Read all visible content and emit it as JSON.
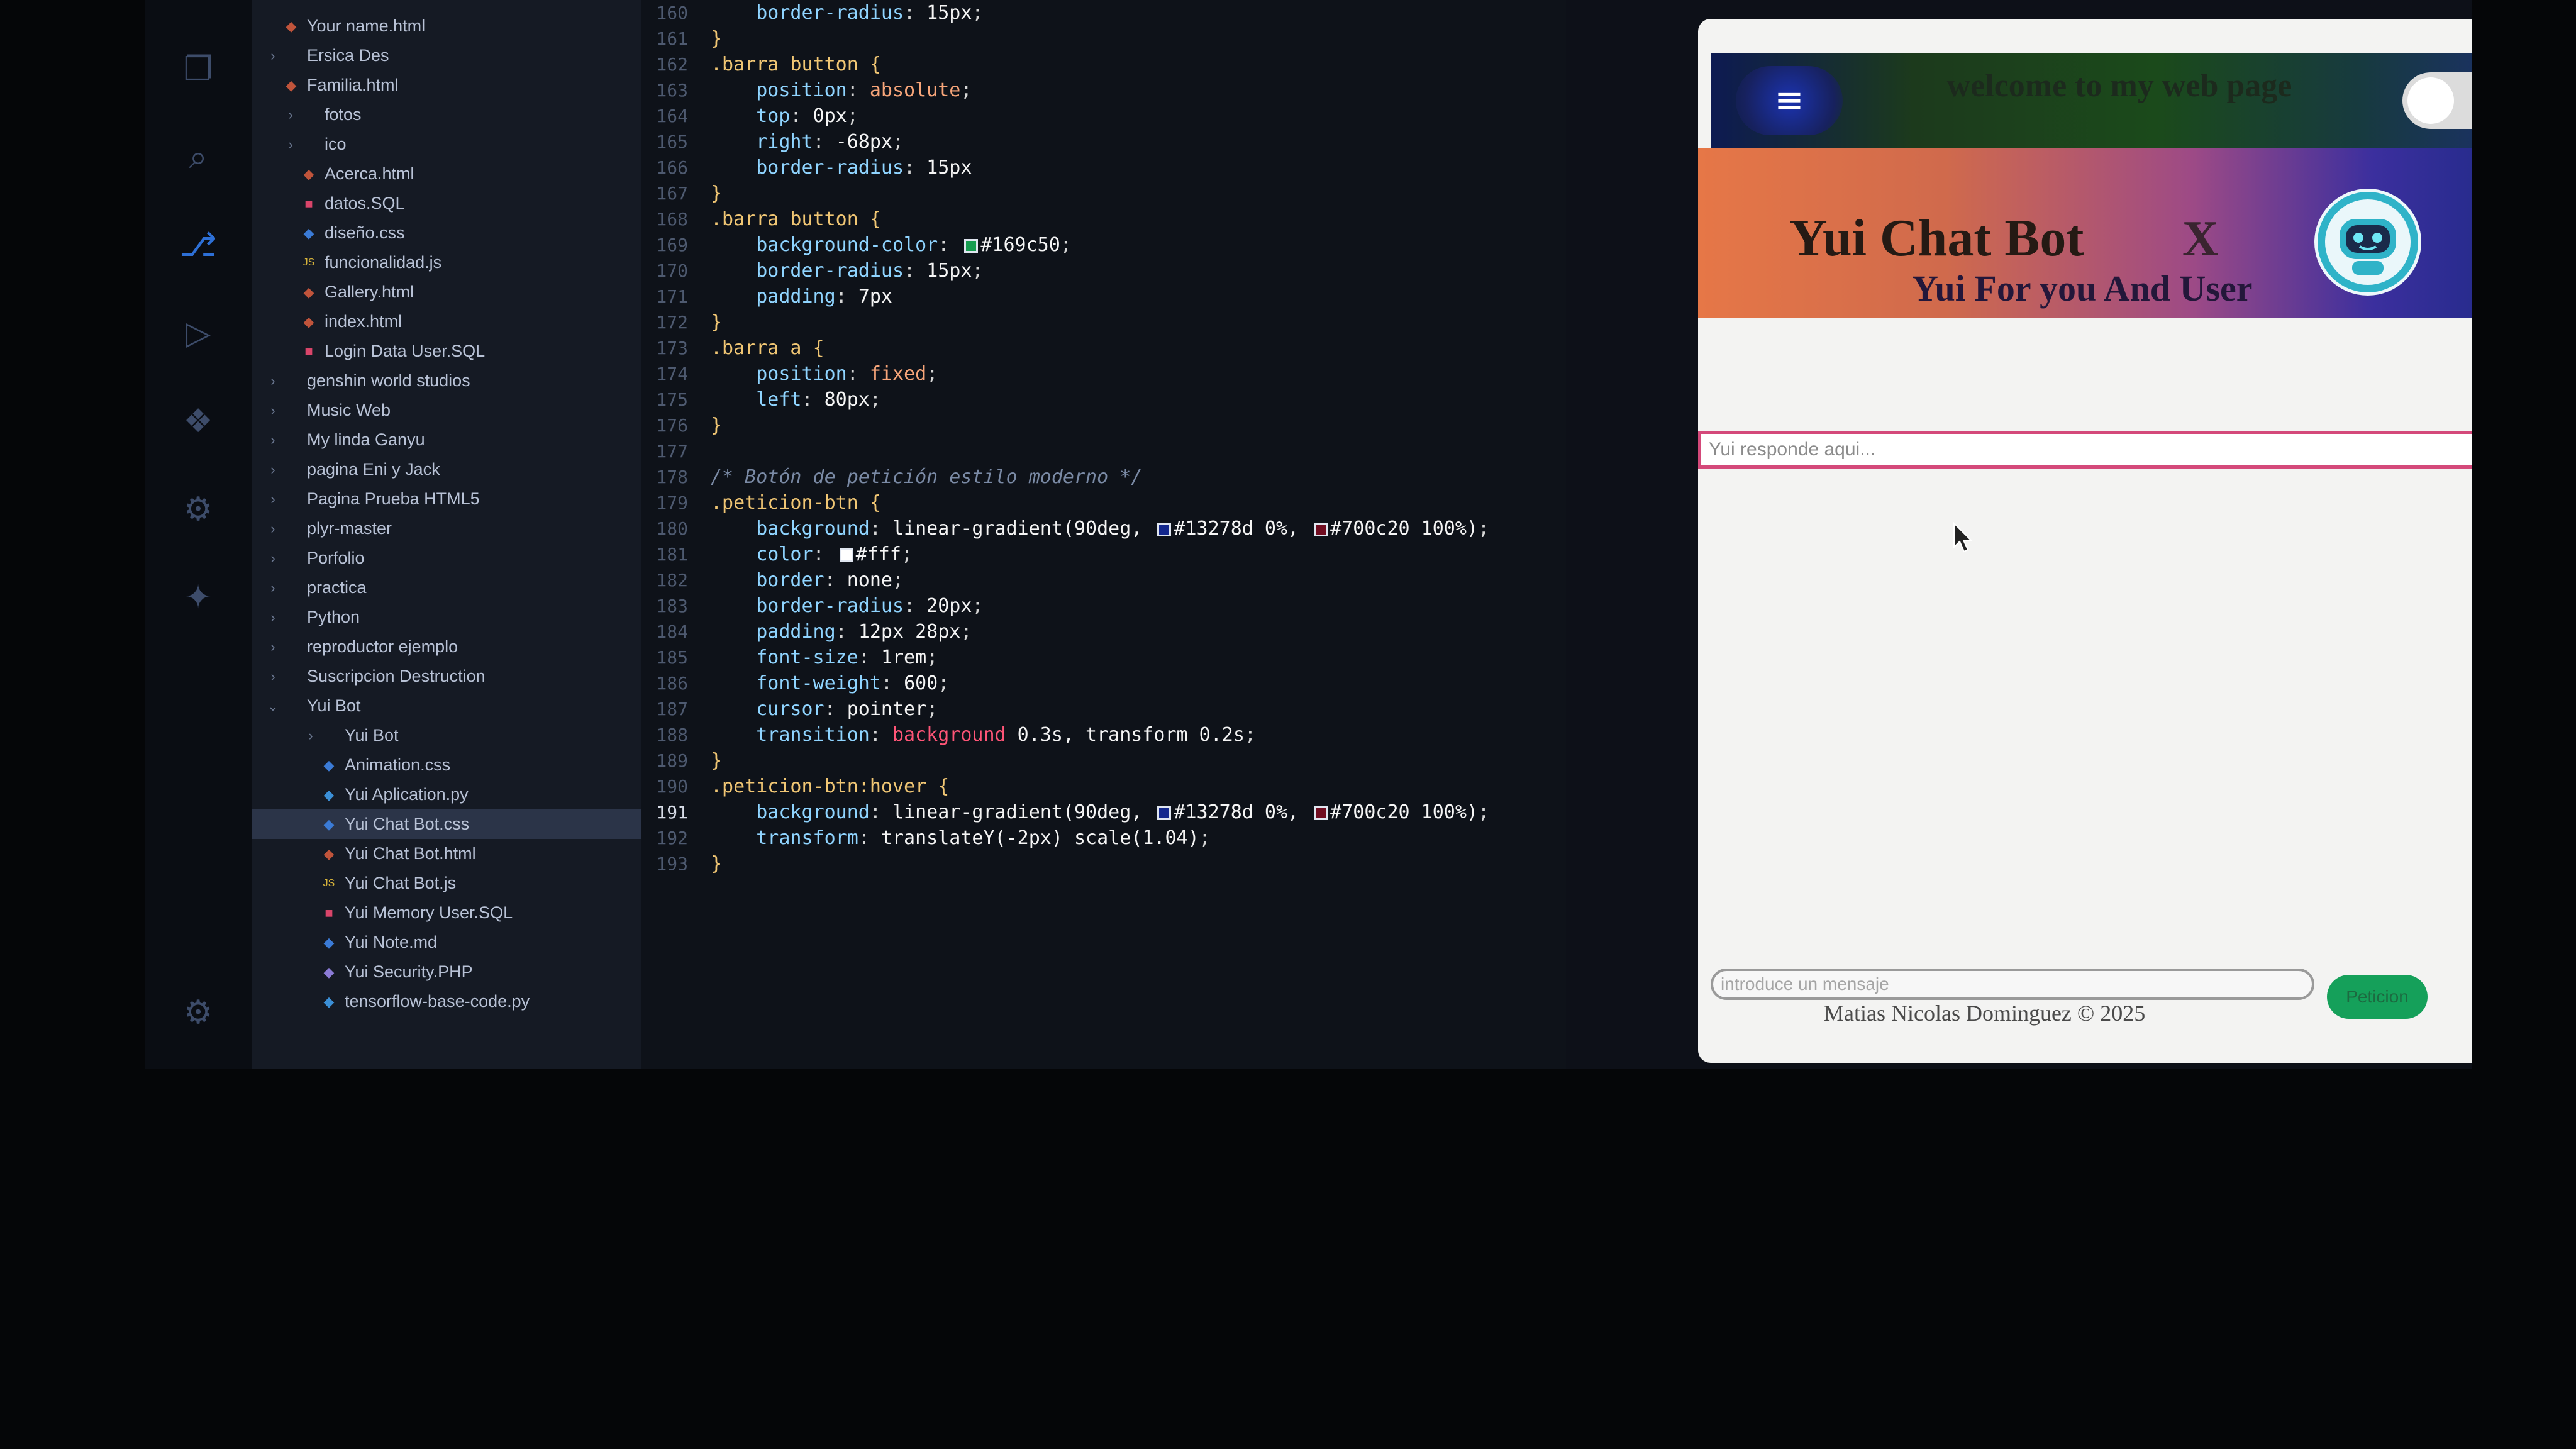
{
  "explorer": {
    "items": [
      {
        "label": "Your name.html",
        "icon": "html-icon",
        "color": "#c0543b"
      },
      {
        "label": "Ersica Des",
        "icon": "folder-icon",
        "color": "#b8c2d6"
      },
      {
        "label": "Familia.html",
        "icon": "html-icon",
        "color": "#c0543b"
      },
      {
        "label": "fotos",
        "icon": "folder-icon",
        "color": "#b8c2d6"
      },
      {
        "label": "ico",
        "icon": "folder-icon",
        "color": "#b8c2d6"
      },
      {
        "label": "Acerca.html",
        "icon": "html-icon",
        "color": "#c0543b"
      },
      {
        "label": "datos.SQL",
        "icon": "database-icon",
        "color": "#d9456a"
      },
      {
        "label": "diseño.css",
        "icon": "css-icon",
        "color": "#3b7bd6"
      },
      {
        "label": "funcionalidad.js",
        "icon": "js-icon",
        "color": "#d6b33b"
      },
      {
        "label": "Gallery.html",
        "icon": "html-icon",
        "color": "#c0543b"
      },
      {
        "label": "index.html",
        "icon": "html-icon",
        "color": "#c0543b"
      },
      {
        "label": "Login Data User.SQL",
        "icon": "database-icon",
        "color": "#d9456a"
      },
      {
        "label": "genshin world studios",
        "icon": "folder-icon",
        "color": "#b8c2d6"
      },
      {
        "label": "Music Web",
        "icon": "folder-icon",
        "color": "#b8c2d6"
      },
      {
        "label": "My linda Ganyu",
        "icon": "folder-icon",
        "color": "#b8c2d6"
      },
      {
        "label": "pagina Eni y Jack",
        "icon": "folder-icon",
        "color": "#b8c2d6"
      },
      {
        "label": "Pagina Prueba HTML5",
        "icon": "folder-icon",
        "color": "#b8c2d6"
      },
      {
        "label": "plyr-master",
        "icon": "folder-icon",
        "color": "#b8c2d6"
      },
      {
        "label": "Porfolio",
        "icon": "folder-icon",
        "color": "#b8c2d6"
      },
      {
        "label": "practica",
        "icon": "folder-icon",
        "color": "#b8c2d6"
      },
      {
        "label": "Python",
        "icon": "folder-icon",
        "color": "#b8c2d6"
      },
      {
        "label": "reproductor ejemplo",
        "icon": "folder-icon",
        "color": "#b8c2d6"
      },
      {
        "label": "Suscripcion Destruction",
        "icon": "folder-icon",
        "color": "#b8c2d6"
      },
      {
        "label": "Yui Bot",
        "icon": "folder-open-icon",
        "color": "#b8c2d6"
      },
      {
        "label": "Yui Bot",
        "icon": "folder-icon",
        "color": "#b8c2d6"
      },
      {
        "label": "Animation.css",
        "icon": "css-icon",
        "color": "#3b7bd6"
      },
      {
        "label": "Yui Aplication.py",
        "icon": "python-icon",
        "color": "#3b8fd6"
      },
      {
        "label": "Yui Chat Bot.css",
        "icon": "css-icon",
        "color": "#3b7bd6"
      },
      {
        "label": "Yui Chat Bot.html",
        "icon": "html-icon",
        "color": "#c0543b"
      },
      {
        "label": "Yui Chat Bot.js",
        "icon": "js-icon",
        "color": "#d6b33b"
      },
      {
        "label": "Yui Memory User.SQL",
        "icon": "database-icon",
        "color": "#d9456a"
      },
      {
        "label": "Yui Note.md",
        "icon": "markdown-icon",
        "color": "#3b7bd6"
      },
      {
        "label": "Yui Security.PHP",
        "icon": "php-icon",
        "color": "#8b7bd6"
      },
      {
        "label": "tensorflow-base-code.py",
        "icon": "python-icon",
        "color": "#3b8fd6"
      }
    ],
    "selected_index": 27
  },
  "editor": {
    "current_line": "191",
    "lines": [
      {
        "n": "160",
        "segs": [
          [
            "tk-prop",
            "    border-radius"
          ],
          [
            "tk-punc",
            ": "
          ],
          [
            "tk-val",
            "15px"
          ],
          [
            "tk-punc",
            ";"
          ]
        ]
      },
      {
        "n": "161",
        "segs": [
          [
            "tk-sel",
            "}"
          ]
        ]
      },
      {
        "n": "162",
        "segs": [
          [
            "tk-sel",
            ".barra button "
          ],
          [
            "tk-sel",
            "{"
          ]
        ]
      },
      {
        "n": "163",
        "segs": [
          [
            "tk-prop",
            "    position"
          ],
          [
            "tk-punc",
            ": "
          ],
          [
            "tk-kw",
            "absolute"
          ],
          [
            "tk-punc",
            ";"
          ]
        ]
      },
      {
        "n": "164",
        "segs": [
          [
            "tk-prop",
            "    top"
          ],
          [
            "tk-punc",
            ": "
          ],
          [
            "tk-val",
            "0px"
          ],
          [
            "tk-punc",
            ";"
          ]
        ]
      },
      {
        "n": "165",
        "segs": [
          [
            "tk-prop",
            "    right"
          ],
          [
            "tk-punc",
            ": "
          ],
          [
            "tk-val",
            "-68px"
          ],
          [
            "tk-punc",
            ";"
          ]
        ]
      },
      {
        "n": "166",
        "segs": [
          [
            "tk-prop",
            "    border-radius"
          ],
          [
            "tk-punc",
            ": "
          ],
          [
            "tk-val",
            "15px"
          ]
        ]
      },
      {
        "n": "167",
        "segs": [
          [
            "tk-sel",
            "}"
          ]
        ]
      },
      {
        "n": "168",
        "segs": [
          [
            "tk-sel",
            ".barra button "
          ],
          [
            "tk-sel",
            "{"
          ]
        ]
      },
      {
        "n": "169",
        "segs": [
          [
            "tk-prop",
            "    background-color"
          ],
          [
            "tk-punc",
            ": "
          ],
          [
            "swatch",
            "#169c50"
          ],
          [
            "tk-val",
            "#169c50"
          ],
          [
            "tk-punc",
            ";"
          ]
        ]
      },
      {
        "n": "170",
        "segs": [
          [
            "tk-prop",
            "    border-radius"
          ],
          [
            "tk-punc",
            ": "
          ],
          [
            "tk-val",
            "15px"
          ],
          [
            "tk-punc",
            ";"
          ]
        ]
      },
      {
        "n": "171",
        "segs": [
          [
            "tk-prop",
            "    padding"
          ],
          [
            "tk-punc",
            ": "
          ],
          [
            "tk-val",
            "7px"
          ]
        ]
      },
      {
        "n": "172",
        "segs": [
          [
            "tk-sel",
            "}"
          ]
        ]
      },
      {
        "n": "173",
        "segs": [
          [
            "tk-sel",
            ".barra a "
          ],
          [
            "tk-sel",
            "{"
          ]
        ]
      },
      {
        "n": "174",
        "segs": [
          [
            "tk-prop",
            "    position"
          ],
          [
            "tk-punc",
            ": "
          ],
          [
            "tk-kw",
            "fixed"
          ],
          [
            "tk-punc",
            ";"
          ]
        ]
      },
      {
        "n": "175",
        "segs": [
          [
            "tk-prop",
            "    left"
          ],
          [
            "tk-punc",
            ": "
          ],
          [
            "tk-val",
            "80px"
          ],
          [
            "tk-punc",
            ";"
          ]
        ]
      },
      {
        "n": "176",
        "segs": [
          [
            "tk-sel",
            "}"
          ]
        ]
      },
      {
        "n": "177",
        "segs": []
      },
      {
        "n": "178",
        "segs": [
          [
            "tk-cmt",
            "/* Botón de petición estilo moderno */"
          ]
        ]
      },
      {
        "n": "179",
        "segs": [
          [
            "tk-sel",
            ".peticion-btn "
          ],
          [
            "tk-sel",
            "{"
          ]
        ]
      },
      {
        "n": "180",
        "segs": [
          [
            "tk-prop",
            "    background"
          ],
          [
            "tk-punc",
            ": "
          ],
          [
            "tk-val",
            "linear-gradient(90deg, "
          ],
          [
            "swatch",
            "#13278d"
          ],
          [
            "tk-val",
            "#13278d 0%, "
          ],
          [
            "swatch",
            "#700c20"
          ],
          [
            "tk-val",
            "#700c20 100%)"
          ],
          [
            "tk-punc",
            ";"
          ]
        ]
      },
      {
        "n": "181",
        "segs": [
          [
            "tk-prop",
            "    color"
          ],
          [
            "tk-punc",
            ": "
          ],
          [
            "swatch",
            "#ffffff"
          ],
          [
            "tk-val",
            "#fff"
          ],
          [
            "tk-punc",
            ";"
          ]
        ]
      },
      {
        "n": "182",
        "segs": [
          [
            "tk-prop",
            "    border"
          ],
          [
            "tk-punc",
            ": "
          ],
          [
            "tk-val",
            "none"
          ],
          [
            "tk-punc",
            ";"
          ]
        ]
      },
      {
        "n": "183",
        "segs": [
          [
            "tk-prop",
            "    border-radius"
          ],
          [
            "tk-punc",
            ": "
          ],
          [
            "tk-val",
            "20px"
          ],
          [
            "tk-punc",
            ";"
          ]
        ]
      },
      {
        "n": "184",
        "segs": [
          [
            "tk-prop",
            "    padding"
          ],
          [
            "tk-punc",
            ": "
          ],
          [
            "tk-val",
            "12px 28px"
          ],
          [
            "tk-punc",
            ";"
          ]
        ]
      },
      {
        "n": "185",
        "segs": [
          [
            "tk-prop",
            "    font-size"
          ],
          [
            "tk-punc",
            ": "
          ],
          [
            "tk-val",
            "1rem"
          ],
          [
            "tk-punc",
            ";"
          ]
        ]
      },
      {
        "n": "186",
        "segs": [
          [
            "tk-prop",
            "    font-weight"
          ],
          [
            "tk-punc",
            ": "
          ],
          [
            "tk-val",
            "600"
          ],
          [
            "tk-punc",
            ";"
          ]
        ]
      },
      {
        "n": "187",
        "segs": [
          [
            "tk-prop",
            "    cursor"
          ],
          [
            "tk-punc",
            ": "
          ],
          [
            "tk-val",
            "pointer"
          ],
          [
            "tk-punc",
            ";"
          ]
        ]
      },
      {
        "n": "188",
        "segs": [
          [
            "tk-prop",
            "    transition"
          ],
          [
            "tk-punc",
            ": "
          ],
          [
            "tk-red",
            "background"
          ],
          [
            "tk-val",
            " 0.3s, transform 0.2s"
          ],
          [
            "tk-punc",
            ";"
          ]
        ]
      },
      {
        "n": "189",
        "segs": [
          [
            "tk-sel",
            "}"
          ]
        ]
      },
      {
        "n": "190",
        "segs": [
          [
            "tk-sel",
            ".peticion-btn:hover "
          ],
          [
            "tk-sel",
            "{"
          ]
        ]
      },
      {
        "n": "191",
        "segs": [
          [
            "tk-prop",
            "    background"
          ],
          [
            "tk-punc",
            ": "
          ],
          [
            "tk-val",
            "linear-gradient(90deg, "
          ],
          [
            "swatch",
            "#13278d"
          ],
          [
            "tk-val",
            "#13278d 0%, "
          ],
          [
            "swatch",
            "#700c20"
          ],
          [
            "tk-val",
            "#700c20 100%)"
          ],
          [
            "tk-punc",
            ";"
          ]
        ]
      },
      {
        "n": "192",
        "segs": [
          [
            "tk-prop",
            "    transform"
          ],
          [
            "tk-punc",
            ": "
          ],
          [
            "tk-val",
            "translateY(-2px) scale(1.04)"
          ],
          [
            "tk-punc",
            ";"
          ]
        ]
      },
      {
        "n": "193",
        "segs": [
          [
            "tk-sel",
            "}"
          ]
        ]
      }
    ]
  },
  "preview": {
    "menu_icon": "hamburger-menu-icon",
    "welcome_text": "welcome to my web page",
    "toggle_state": "off",
    "title": "Yui Chat Bot",
    "close_label": "X",
    "subtitle": "Yui For you And User",
    "avatar_icon": "robot-avatar-icon",
    "response_placeholder": "Yui responde aqui...",
    "message_placeholder": "introduce un mensaje",
    "send_label": "Peticion",
    "footer": "Matias Nicolas Dominguez © 2025",
    "colors": {
      "send_button": "#169c50",
      "response_border": "#d4497a"
    }
  }
}
